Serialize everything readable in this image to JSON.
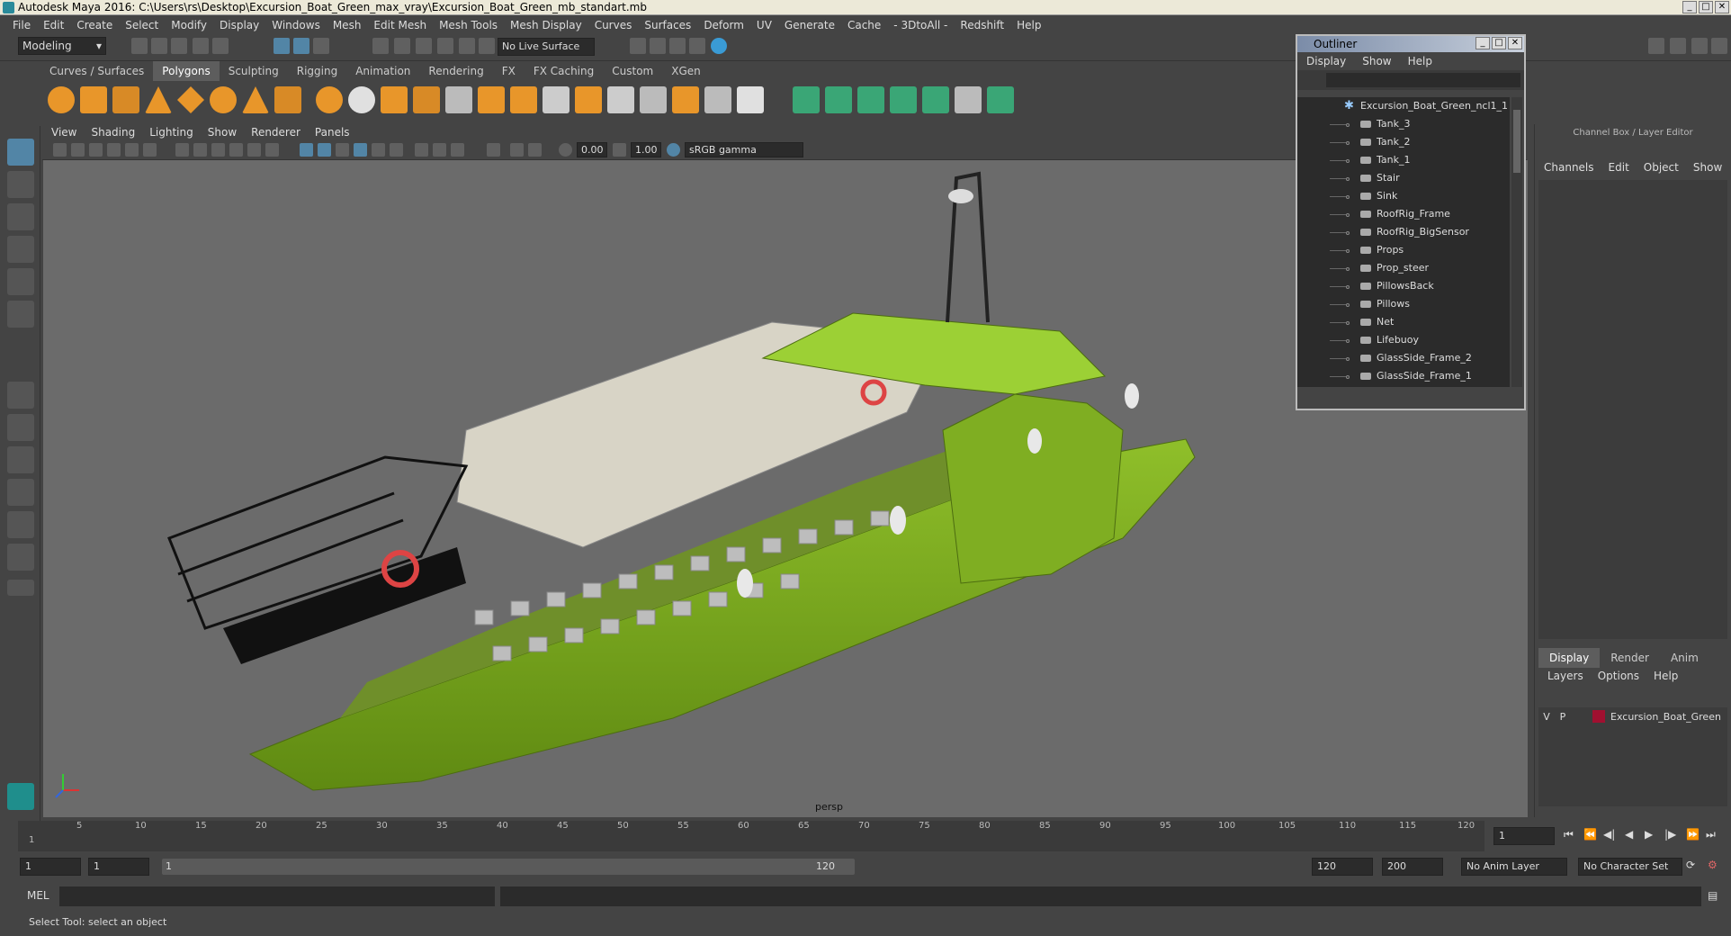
{
  "window": {
    "title": "Autodesk Maya 2016: C:\\Users\\rs\\Desktop\\Excursion_Boat_Green_max_vray\\Excursion_Boat_Green_mb_standart.mb"
  },
  "menu": [
    "File",
    "Edit",
    "Create",
    "Select",
    "Modify",
    "Display",
    "Windows",
    "Mesh",
    "Edit Mesh",
    "Mesh Tools",
    "Mesh Display",
    "Curves",
    "Surfaces",
    "Deform",
    "UV",
    "Generate",
    "Cache",
    "- 3DtoAll -",
    "Redshift",
    "Help"
  ],
  "toolbar": {
    "mode": "Modeling",
    "live_surface": "No Live Surface"
  },
  "shelf_tabs": [
    "Curves / Surfaces",
    "Polygons",
    "Sculpting",
    "Rigging",
    "Animation",
    "Rendering",
    "FX",
    "FX Caching",
    "Custom",
    "XGen"
  ],
  "viewport": {
    "menu": [
      "View",
      "Shading",
      "Lighting",
      "Show",
      "Renderer",
      "Panels"
    ],
    "exposure": "0.00",
    "gamma": "1.00",
    "color_space": "sRGB gamma",
    "camera": "persp"
  },
  "outliner": {
    "title": "Outliner",
    "menu": [
      "Display",
      "Show",
      "Help"
    ],
    "root": "Excursion_Boat_Green_ncl1_1",
    "items": [
      "Tank_3",
      "Tank_2",
      "Tank_1",
      "Stair",
      "Sink",
      "RoofRig_Frame",
      "RoofRig_BigSensor",
      "Props",
      "Prop_steer",
      "PillowsBack",
      "Pillows",
      "Net",
      "Lifebuoy",
      "GlassSide_Frame_2",
      "GlassSide_Frame_1"
    ]
  },
  "channel_box": {
    "title": "Channel Box / Layer Editor",
    "menu": [
      "Channels",
      "Edit",
      "Object",
      "Show"
    ],
    "layer_tabs": [
      "Display",
      "Render",
      "Anim"
    ],
    "layer_menu": [
      "Layers",
      "Options",
      "Help"
    ],
    "layer": {
      "v": "V",
      "p": "P",
      "name": "Excursion_Boat_Green",
      "color": "#a01030"
    }
  },
  "timeline": {
    "ticks": [
      "5",
      "10",
      "15",
      "20",
      "25",
      "30",
      "35",
      "40",
      "45",
      "50",
      "55",
      "60",
      "65",
      "70",
      "75",
      "80",
      "85",
      "90",
      "95",
      "100",
      "105",
      "110",
      "115",
      "120"
    ],
    "current_start": "1",
    "current_frame": "1"
  },
  "range": {
    "start": "1",
    "start2": "1",
    "slider_left": "1",
    "slider_right": "120",
    "end": "120",
    "end2": "200",
    "anim_layer": "No Anim Layer",
    "character_set": "No Character Set"
  },
  "mel": {
    "label": "MEL"
  },
  "status": {
    "text": "Select Tool: select an object"
  }
}
